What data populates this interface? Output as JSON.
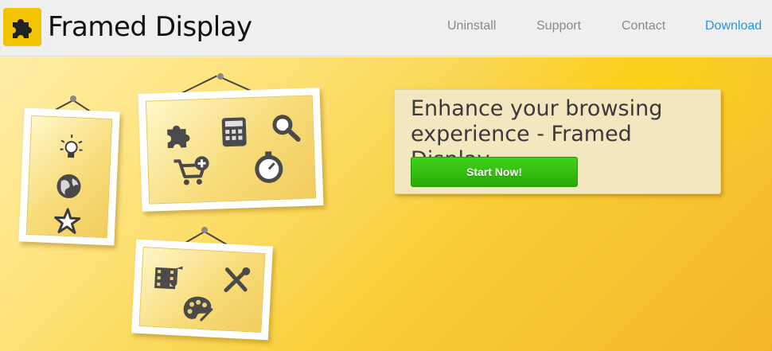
{
  "brand": {
    "name": "Framed Display",
    "icon": "puzzle-piece-icon",
    "color": "#f2c300"
  },
  "nav": {
    "items": [
      {
        "label": "Uninstall"
      },
      {
        "label": "Support"
      },
      {
        "label": "Contact"
      },
      {
        "label": "Download"
      }
    ],
    "active_color": "#2a93d8"
  },
  "hero": {
    "headline": "Enhance your browsing experience - Framed Display.",
    "cta_label": "Start Now!",
    "cta_color": "#33c010",
    "frames": [
      {
        "icons": [
          "lightbulb-icon",
          "globe-icon",
          "star-icon"
        ]
      },
      {
        "icons": [
          "puzzle-piece-icon",
          "calculator-icon",
          "magnifier-icon",
          "shopping-cart-add-icon",
          "stopwatch-icon"
        ]
      },
      {
        "icons": [
          "film-music-icon",
          "wrench-screwdriver-icon",
          "paint-palette-icon"
        ]
      }
    ]
  }
}
